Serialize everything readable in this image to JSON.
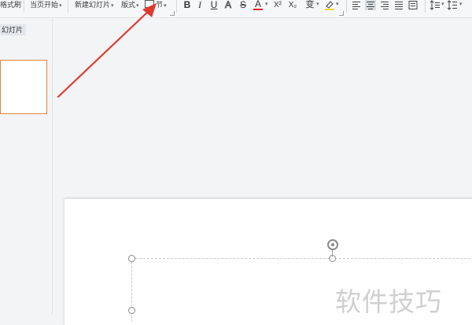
{
  "window_title": "",
  "ribbon": {
    "format_painter": "格式刷",
    "start_page": "当页开始",
    "new_slide": "新建幻灯片",
    "layout": "版式",
    "section": "节",
    "bold": "B",
    "italic": "I",
    "underline": "U",
    "shadow": "A",
    "strikethrough": "S",
    "font_color": "A",
    "superscript": "X²",
    "subscript": "X₂",
    "change_case": "变"
  },
  "left_panel": {
    "tab_label": "幻灯片"
  },
  "watermark": "软件技巧",
  "colors": {
    "accent_orange": "#e0853f",
    "arrow_red": "#e03a2e",
    "font_color_red": "#e22222",
    "highlight_yellow": "#f1d632",
    "selected_align": "#d9dee5"
  }
}
